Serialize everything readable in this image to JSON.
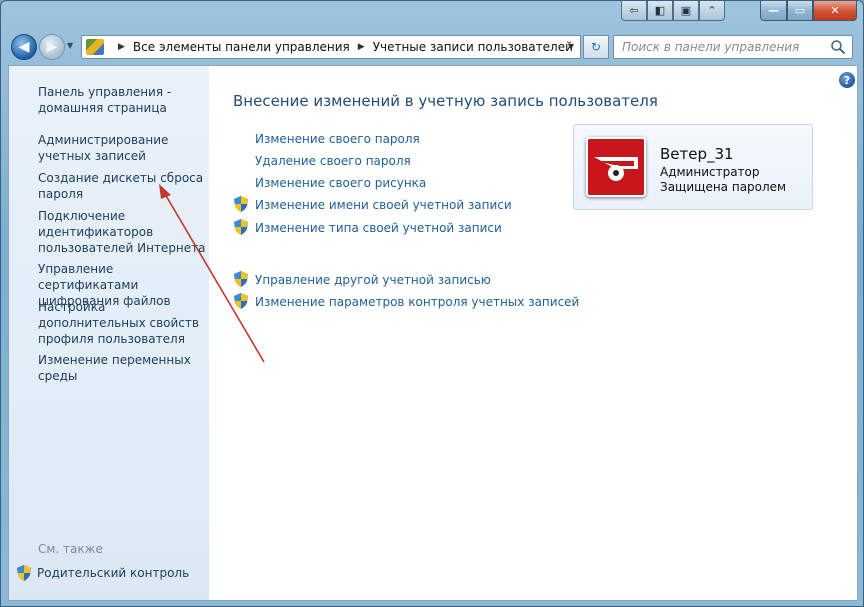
{
  "window": {
    "extra_buttons": [
      "⇦",
      "◧",
      "▣",
      "⌃"
    ],
    "caption": {
      "minimize": "—",
      "maximize": "▭",
      "close": "✕"
    }
  },
  "nav": {
    "back_symbol": "◀",
    "forward_symbol": "▶",
    "breadcrumb": [
      "Все элементы панели управления",
      "Учетные записи пользователей"
    ],
    "refresh_symbol": "↻",
    "search_placeholder": "Поиск в панели управления"
  },
  "sidebar": {
    "items": [
      "Панель управления - домашняя страница",
      "Администрирование учетных записей",
      "Создание дискеты сброса пароля",
      "Подключение идентификаторов пользователей Интернета",
      "Управление сертификатами шифрования файлов",
      "Настройка дополнительных свойств профиля пользователя",
      "Изменение переменных среды"
    ],
    "see_also": "См. также",
    "parental_control": "Родительский контроль"
  },
  "main": {
    "help": "?",
    "heading": "Внесение изменений в учетную запись пользователя",
    "tasks": [
      "Изменение своего пароля",
      "Удаление своего пароля",
      "Изменение своего рисунка",
      "Изменение имени своей учетной записи",
      "Изменение типа своей учетной записи"
    ],
    "other_tasks": [
      "Управление другой учетной записью",
      "Изменение параметров контроля учетных записей"
    ]
  },
  "user": {
    "name": "Ветер_31",
    "role": "Администратор",
    "status": "Защищена паролем"
  },
  "colors": {
    "link": "#1f5f9a",
    "heading": "#1f4e79",
    "annotation_arrow": "#c0392b"
  }
}
